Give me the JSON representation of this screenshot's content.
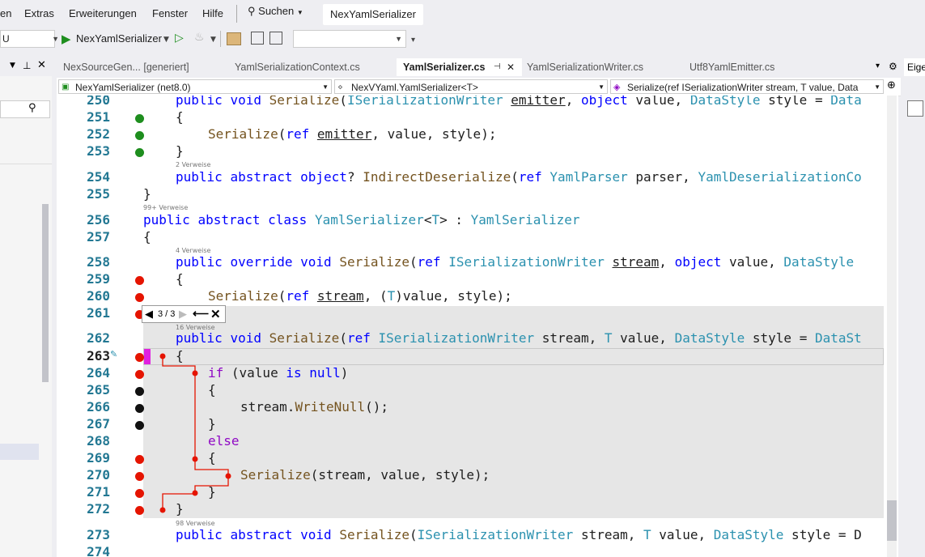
{
  "menu": {
    "items": [
      "en",
      "Extras",
      "Erweiterungen",
      "Fenster",
      "Hilfe"
    ],
    "search_label": "Suchen",
    "solution": "NexYamlSerializer"
  },
  "toolbar": {
    "config_value": "U",
    "startup_project": "NexYamlSerializer"
  },
  "tabs": [
    {
      "label": "NexSourceGen... [generiert]",
      "active": false
    },
    {
      "label": "YamlSerializationContext.cs",
      "active": false
    },
    {
      "label": "YamlSerializer.cs",
      "active": true
    },
    {
      "label": "YamlSerializationWriter.cs",
      "active": false
    },
    {
      "label": "Utf8YamlEmitter.cs",
      "active": false
    }
  ],
  "right_panel_label": "Eige",
  "navbar": {
    "project": "NexYamlSerializer (net8.0)",
    "type": "NexVYaml.YamlSerializer<T>",
    "member": "Serialize(ref ISerializationWriter stream, T value, Data"
  },
  "nav_toolbar": {
    "counter": "3 / 3"
  },
  "ref_hints": {
    "r254": "2 Verweise",
    "r256": "99+ Verweise",
    "r258": "4 Verweise",
    "r262": "16 Verweise",
    "r273": "98 Verweise"
  },
  "line_numbers": [
    "250",
    "251",
    "252",
    "253",
    "254",
    "255",
    "256",
    "257",
    "258",
    "259",
    "260",
    "261",
    "262",
    "263",
    "264",
    "265",
    "266",
    "267",
    "268",
    "269",
    "270",
    "271",
    "272",
    "273",
    "274"
  ],
  "colors": {
    "accent": "#2b91af",
    "breakpoint": "#e51400",
    "coverage": "#1e8e1e",
    "highlight": "#e6e6e6"
  }
}
